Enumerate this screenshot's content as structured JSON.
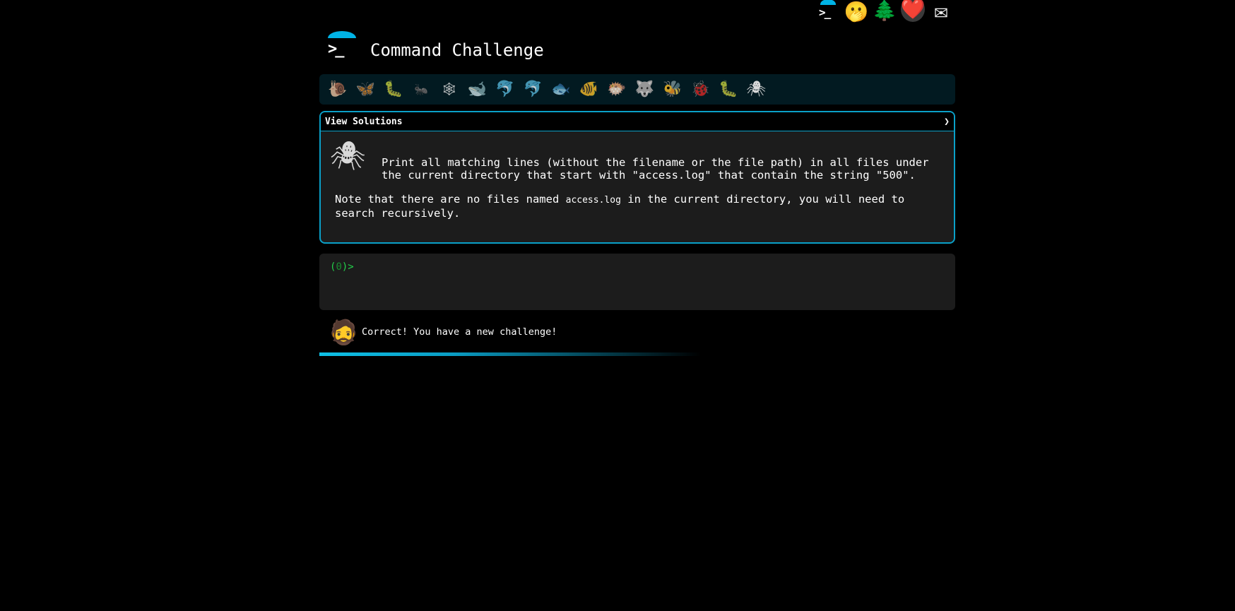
{
  "topbar": {
    "icons": [
      "terminal-icon",
      "thinking-face-icon",
      "evergreen-tree-icon",
      "heart-icon",
      "envelope-icon"
    ],
    "terminal_glyph": ">_",
    "think_glyph": "🫢",
    "tree_glyph": "🌲",
    "heart_glyph": "❤️",
    "mail_glyph": "✉"
  },
  "header": {
    "logo_glyph": ">_",
    "title": "Command Challenge"
  },
  "animals": [
    {
      "name": "snail",
      "glyph": "🐌"
    },
    {
      "name": "butterfly",
      "glyph": "🦋"
    },
    {
      "name": "caterpillar",
      "glyph": "🐛"
    },
    {
      "name": "ant",
      "glyph": "🐜"
    },
    {
      "name": "spider-web",
      "glyph": "🕸"
    },
    {
      "name": "whale",
      "glyph": "🐋"
    },
    {
      "name": "dolphin",
      "glyph": "🐬"
    },
    {
      "name": "shark",
      "glyph": "🐬"
    },
    {
      "name": "fish",
      "glyph": "🐟"
    },
    {
      "name": "tropical-fish",
      "glyph": "🐠"
    },
    {
      "name": "blowfish",
      "glyph": "🐡"
    },
    {
      "name": "wolf",
      "glyph": "🐺"
    },
    {
      "name": "bee",
      "glyph": "🐝"
    },
    {
      "name": "ladybug",
      "glyph": "🐞"
    },
    {
      "name": "worm",
      "glyph": "🐛"
    },
    {
      "name": "spider",
      "glyph": "🕷"
    }
  ],
  "panel": {
    "title": "View Solutions",
    "chevron": "❯",
    "spider_glyph": "🕷",
    "description": "Print all matching lines (without the filename or the file path) in all files under the current directory that start with \"access.log\" that contain the string \"500\".",
    "note_prefix": "Note that there are no files named ",
    "note_code": "access.log",
    "note_suffix": " in the current directory, you will need to search recursively."
  },
  "terminal": {
    "prompt_open": "(",
    "prompt_num": "0",
    "prompt_close": ")>",
    "input_value": ""
  },
  "status": {
    "avatar_glyph": "🧔",
    "message": "Correct! You have a new challenge!"
  },
  "colors": {
    "accent": "#0aa0c8",
    "prompt": "#23d14a",
    "panel_bg": "#1c1c1c",
    "bar_bg": "#021a21"
  }
}
